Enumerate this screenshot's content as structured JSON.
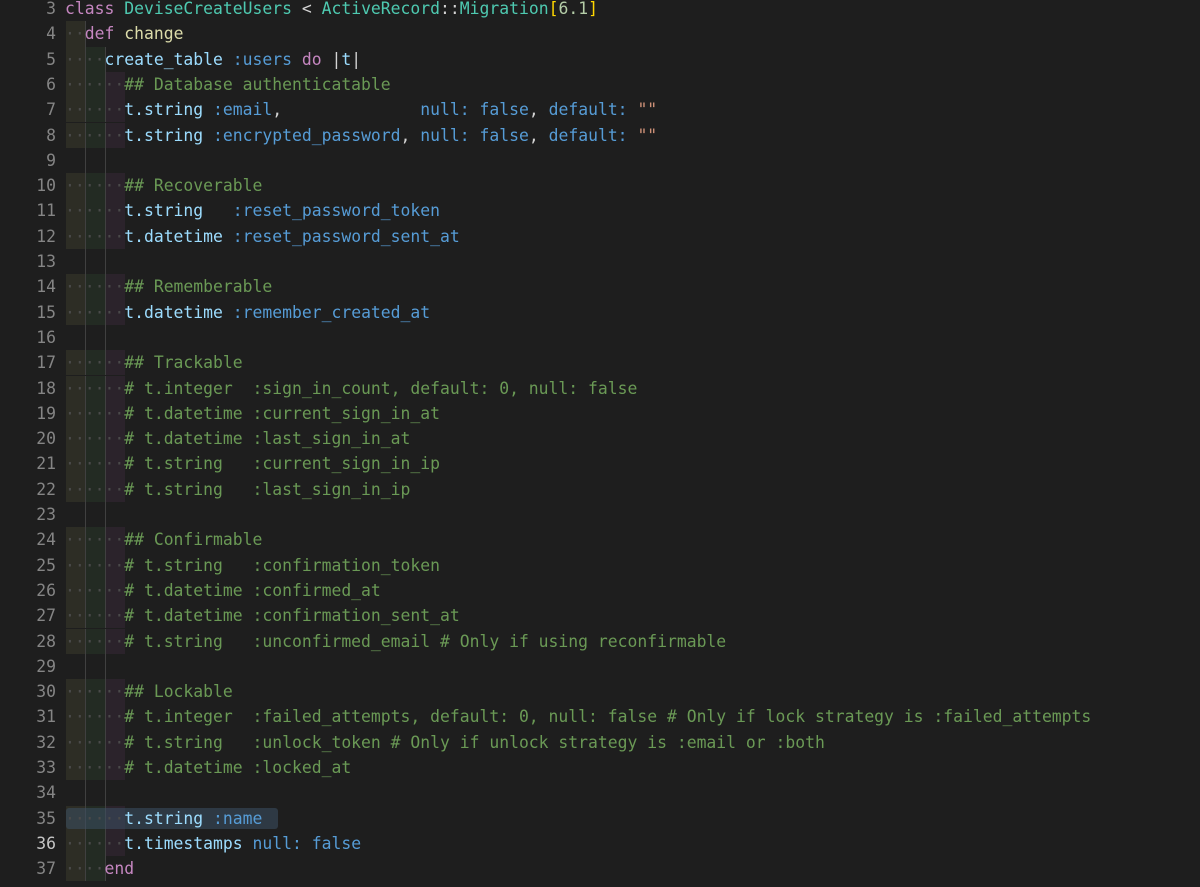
{
  "editor": {
    "active_line": 36,
    "colors": {
      "background": "#1e1e1e",
      "keyword": "#c586c0",
      "class": "#4ec9b0",
      "symbol": "#569cd6",
      "string": "#ce9178",
      "comment": "#6a9955"
    },
    "lines": [
      {
        "n": "3",
        "indent": 0,
        "tokens": [
          {
            "t": "class",
            "c": "kw"
          },
          {
            "t": " ",
            "c": "wht"
          },
          {
            "t": "DeviseCreateUsers",
            "c": "cls"
          },
          {
            "t": " < ",
            "c": "wht"
          },
          {
            "t": "ActiveRecord",
            "c": "cls"
          },
          {
            "t": "::",
            "c": "wht"
          },
          {
            "t": "Migration",
            "c": "cls"
          },
          {
            "t": "[",
            "c": "br"
          },
          {
            "t": "6.1",
            "c": "num"
          },
          {
            "t": "]",
            "c": "br"
          }
        ]
      },
      {
        "n": "4",
        "indent": 1,
        "tokens": [
          {
            "t": "def",
            "c": "kw"
          },
          {
            "t": " ",
            "c": "wht"
          },
          {
            "t": "change",
            "c": "fn"
          }
        ]
      },
      {
        "n": "5",
        "indent": 2,
        "tokens": [
          {
            "t": "create_table",
            "c": "plain"
          },
          {
            "t": " ",
            "c": "wht"
          },
          {
            "t": ":users",
            "c": "sym"
          },
          {
            "t": " ",
            "c": "wht"
          },
          {
            "t": "do",
            "c": "kw"
          },
          {
            "t": " |",
            "c": "wht"
          },
          {
            "t": "t",
            "c": "plain"
          },
          {
            "t": "|",
            "c": "wht"
          }
        ]
      },
      {
        "n": "6",
        "indent": 3,
        "tokens": [
          {
            "t": "## Database authenticatable",
            "c": "cm"
          }
        ]
      },
      {
        "n": "7",
        "indent": 3,
        "tokens": [
          {
            "t": "t.string",
            "c": "plain"
          },
          {
            "t": " ",
            "c": "wht"
          },
          {
            "t": ":email",
            "c": "sym"
          },
          {
            "t": ",              ",
            "c": "wht"
          },
          {
            "t": "null:",
            "c": "sym"
          },
          {
            "t": " ",
            "c": "wht"
          },
          {
            "t": "false",
            "c": "sym"
          },
          {
            "t": ", ",
            "c": "wht"
          },
          {
            "t": "default:",
            "c": "sym"
          },
          {
            "t": " ",
            "c": "wht"
          },
          {
            "t": "\"\"",
            "c": "str"
          }
        ]
      },
      {
        "n": "8",
        "indent": 3,
        "tokens": [
          {
            "t": "t.string",
            "c": "plain"
          },
          {
            "t": " ",
            "c": "wht"
          },
          {
            "t": ":encrypted_password",
            "c": "sym"
          },
          {
            "t": ", ",
            "c": "wht"
          },
          {
            "t": "null:",
            "c": "sym"
          },
          {
            "t": " ",
            "c": "wht"
          },
          {
            "t": "false",
            "c": "sym"
          },
          {
            "t": ", ",
            "c": "wht"
          },
          {
            "t": "default:",
            "c": "sym"
          },
          {
            "t": " ",
            "c": "wht"
          },
          {
            "t": "\"\"",
            "c": "str"
          }
        ]
      },
      {
        "n": "9",
        "indent": 0,
        "tokens": []
      },
      {
        "n": "10",
        "indent": 3,
        "tokens": [
          {
            "t": "## Recoverable",
            "c": "cm"
          }
        ]
      },
      {
        "n": "11",
        "indent": 3,
        "tokens": [
          {
            "t": "t.string",
            "c": "plain"
          },
          {
            "t": "   ",
            "c": "wht"
          },
          {
            "t": ":reset_password_token",
            "c": "sym"
          }
        ]
      },
      {
        "n": "12",
        "indent": 3,
        "tokens": [
          {
            "t": "t.datetime",
            "c": "plain"
          },
          {
            "t": " ",
            "c": "wht"
          },
          {
            "t": ":reset_password_sent_at",
            "c": "sym"
          }
        ]
      },
      {
        "n": "13",
        "indent": 0,
        "tokens": []
      },
      {
        "n": "14",
        "indent": 3,
        "tokens": [
          {
            "t": "## Rememberable",
            "c": "cm"
          }
        ]
      },
      {
        "n": "15",
        "indent": 3,
        "tokens": [
          {
            "t": "t.datetime",
            "c": "plain"
          },
          {
            "t": " ",
            "c": "wht"
          },
          {
            "t": ":remember_created_at",
            "c": "sym"
          }
        ]
      },
      {
        "n": "16",
        "indent": 0,
        "tokens": []
      },
      {
        "n": "17",
        "indent": 3,
        "tokens": [
          {
            "t": "## Trackable",
            "c": "cm"
          }
        ]
      },
      {
        "n": "18",
        "indent": 3,
        "tokens": [
          {
            "t": "# t.integer  :sign_in_count, default: 0, null: false",
            "c": "cm"
          }
        ]
      },
      {
        "n": "19",
        "indent": 3,
        "tokens": [
          {
            "t": "# t.datetime :current_sign_in_at",
            "c": "cm"
          }
        ]
      },
      {
        "n": "20",
        "indent": 3,
        "tokens": [
          {
            "t": "# t.datetime :last_sign_in_at",
            "c": "cm"
          }
        ]
      },
      {
        "n": "21",
        "indent": 3,
        "tokens": [
          {
            "t": "# t.string   :current_sign_in_ip",
            "c": "cm"
          }
        ]
      },
      {
        "n": "22",
        "indent": 3,
        "tokens": [
          {
            "t": "# t.string   :last_sign_in_ip",
            "c": "cm"
          }
        ]
      },
      {
        "n": "23",
        "indent": 0,
        "tokens": []
      },
      {
        "n": "24",
        "indent": 3,
        "tokens": [
          {
            "t": "## Confirmable",
            "c": "cm"
          }
        ]
      },
      {
        "n": "25",
        "indent": 3,
        "tokens": [
          {
            "t": "# t.string   :confirmation_token",
            "c": "cm"
          }
        ]
      },
      {
        "n": "26",
        "indent": 3,
        "tokens": [
          {
            "t": "# t.datetime :confirmed_at",
            "c": "cm"
          }
        ]
      },
      {
        "n": "27",
        "indent": 3,
        "tokens": [
          {
            "t": "# t.datetime :confirmation_sent_at",
            "c": "cm"
          }
        ]
      },
      {
        "n": "28",
        "indent": 3,
        "tokens": [
          {
            "t": "# t.string   :unconfirmed_email # Only if using reconfirmable",
            "c": "cm"
          }
        ]
      },
      {
        "n": "29",
        "indent": 0,
        "tokens": []
      },
      {
        "n": "30",
        "indent": 3,
        "tokens": [
          {
            "t": "## Lockable",
            "c": "cm"
          }
        ]
      },
      {
        "n": "31",
        "indent": 3,
        "tokens": [
          {
            "t": "# t.integer  :failed_attempts, default: 0, null: false # Only if lock strategy is :failed_attempts",
            "c": "cm"
          }
        ]
      },
      {
        "n": "32",
        "indent": 3,
        "tokens": [
          {
            "t": "# t.string   :unlock_token # Only if unlock strategy is :email or :both",
            "c": "cm"
          }
        ]
      },
      {
        "n": "33",
        "indent": 3,
        "tokens": [
          {
            "t": "# t.datetime :locked_at",
            "c": "cm"
          }
        ]
      },
      {
        "n": "34",
        "indent": 0,
        "tokens": []
      },
      {
        "n": "35",
        "indent": 3,
        "selected": true,
        "tokens": [
          {
            "t": "t.string",
            "c": "plain"
          },
          {
            "t": " ",
            "c": "wht"
          },
          {
            "t": ":name",
            "c": "sym"
          }
        ]
      },
      {
        "n": "36",
        "indent": 3,
        "tokens": [
          {
            "t": "t.timestamps",
            "c": "plain"
          },
          {
            "t": " ",
            "c": "wht"
          },
          {
            "t": "null:",
            "c": "sym"
          },
          {
            "t": " ",
            "c": "wht"
          },
          {
            "t": "false",
            "c": "sym"
          }
        ]
      },
      {
        "n": "37",
        "indent": 2,
        "tokens": [
          {
            "t": "end",
            "c": "kw"
          }
        ]
      }
    ]
  }
}
